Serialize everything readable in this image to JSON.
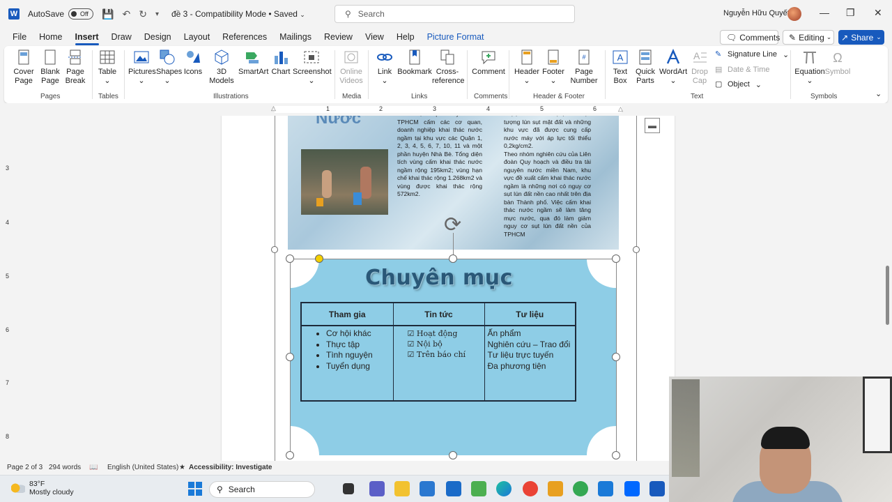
{
  "titlebar": {
    "autosave_label": "AutoSave",
    "autosave_state": "Off",
    "doc_title": "đề 3  -  Compatibility Mode • Saved",
    "search_placeholder": "Search",
    "user_name": "Nguyễn Hữu Quyết"
  },
  "menu": {
    "items": [
      "File",
      "Home",
      "Insert",
      "Draw",
      "Design",
      "Layout",
      "References",
      "Mailings",
      "Review",
      "View",
      "Help",
      "Picture Format"
    ],
    "active": "Insert",
    "comments_label": "Comments",
    "editing_label": "Editing",
    "share_label": "Share"
  },
  "ribbon": {
    "pages": {
      "cover_page": "Cover\nPage",
      "blank_page": "Blank\nPage",
      "page_break": "Page\nBreak",
      "label": "Pages"
    },
    "tables": {
      "table": "Table",
      "label": "Tables"
    },
    "illustrations": {
      "pictures": "Pictures",
      "shapes": "Shapes",
      "icons": "Icons",
      "models3d": "3D\nModels",
      "smartart": "SmartArt",
      "chart": "Chart",
      "screenshot": "Screenshot",
      "label": "Illustrations"
    },
    "media": {
      "online_videos": "Online\nVideos",
      "label": "Media"
    },
    "links": {
      "link": "Link",
      "bookmark": "Bookmark",
      "cross_reference": "Cross-\nreference",
      "label": "Links"
    },
    "comments": {
      "comment": "Comment",
      "label": "Comments"
    },
    "header_footer": {
      "header": "Header",
      "footer": "Footer",
      "page_number": "Page\nNumber",
      "label": "Header & Footer"
    },
    "text": {
      "text_box": "Text\nBox",
      "quick_parts": "Quick\nParts",
      "wordart": "WordArt",
      "drop_cap": "Drop\nCap",
      "signature_line": "Signature Line",
      "date_time": "Date & Time",
      "object": "Object",
      "label": "Text"
    },
    "symbols": {
      "equation": "Equation",
      "symbol": "Symbol",
      "label": "Symbols"
    }
  },
  "ruler": {
    "numbers": [
      "1",
      "2",
      "3",
      "4",
      "5",
      "6"
    ],
    "vnumbers": [
      "3",
      "4",
      "5",
      "6",
      "7",
      "8"
    ]
  },
  "document": {
    "water_title": "Nước",
    "col1_text": "Theo đó, cơ quan này đề xuất TPHCM cấm các cơ quan, doanh nghiệp khai thác nước ngầm tại khu vực các Quận 1, 2, 3, 4, 5, 6, 7, 10, 11 và một phần huyện Nhà Bè. Tổng diện tích vùng cấm khai thác nước ngầm rộng 195km2; vùng hạn chế khai thác rộng 1.268km2 và vùng được khai thác rộng 572km2.",
    "col2_text": "nhạt, ô nhiễm mặn, có hiện tượng lún sụt mặt đất và những khu vực đã được cung cấp nước máy với áp lực tối thiểu 0,2kg/cm2.\nTheo nhóm nghiên cứu của Liên đoàn Quy hoạch và điều tra tài nguyên nước miền Nam, khu vực đề xuất cấm khai thác nước ngầm là những nơi có nguy cơ sụt lún đất nền cao nhất trên địa bàn Thành phố. Việc cấm khai thác nước ngầm sẽ làm tăng mực nước, qua đó làm giảm nguy cơ sụt lún đất nền của TPHCM",
    "section_title": "Chuyên mục",
    "table": {
      "headers": [
        "Tham gia",
        "Tin tức",
        "Tư liệu"
      ],
      "col1": [
        "Cơ hội khác",
        "Thực tập",
        "Tình nguyện",
        "Tuyển dụng"
      ],
      "col2": [
        "Hoạt động",
        "Nội bộ",
        "Trên báo chí"
      ],
      "col3": [
        "Ấn phẩm",
        "Nghiên cứu – Trao đổi",
        "Tư liệu trực tuyến",
        "Đa phương tiện"
      ]
    }
  },
  "statusbar": {
    "page": "Page 2 of 3",
    "words": "294 words",
    "language": "English (United States)",
    "accessibility": "Accessibility: Investigate"
  },
  "taskbar": {
    "temperature": "83°F",
    "weather": "Mostly cloudy",
    "search_label": "Search"
  },
  "colors": {
    "accent": "#185abd",
    "box_blue": "#8ecde6",
    "title_text": "#2a5878"
  }
}
